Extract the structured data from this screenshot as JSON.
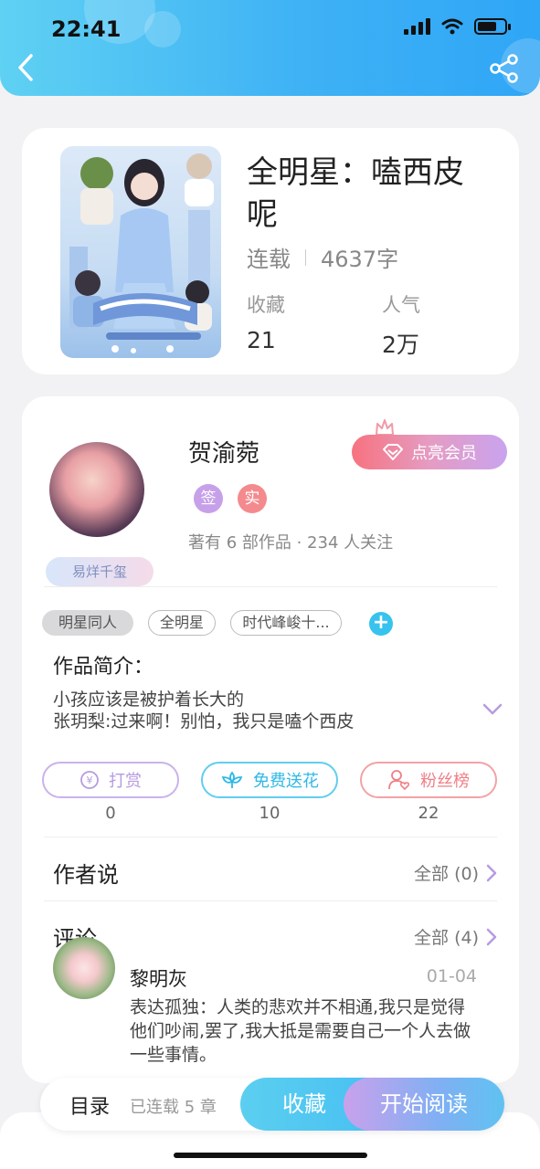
{
  "status_bar": {
    "time": "22:41"
  },
  "book": {
    "title": "全明星：嗑西皮呢",
    "status": "连载",
    "word_count": "4637字",
    "favorites_label": "收藏",
    "favorites_value": "21",
    "popularity_label": "人气",
    "popularity_value": "2万"
  },
  "author": {
    "name": "贺渝菀",
    "vip_label": "点亮会员",
    "tag_sign": "签",
    "tag_real": "实",
    "stats": "著有 6 部作品 · 234 人关注",
    "badge": "易烊千玺"
  },
  "tags": [
    "明星同人",
    "全明星",
    "时代峰峻十..."
  ],
  "intro": {
    "title": "作品简介：",
    "line1": "小孩应该是被护着长大的",
    "line2": "张玥梨:过来啊！别怕，我只是嗑个西皮"
  },
  "actions": [
    {
      "label": "打赏",
      "count": "0",
      "color": "#b9a2e3"
    },
    {
      "label": "免费送花",
      "count": "10",
      "color": "#3cc7ec"
    },
    {
      "label": "粉丝榜",
      "count": "22",
      "color": "#ef8a8f"
    }
  ],
  "author_says": {
    "title": "作者说",
    "link": "全部 (0)"
  },
  "comments": {
    "title": "评论",
    "link": "全部 (4)",
    "items": [
      {
        "user": "黎明灰",
        "date": "01-04",
        "text": "表达孤独：人类的悲欢并不相通,我只是觉得他们吵闹,罢了,我大抵是需要自己一个人去做一些事情。"
      }
    ]
  },
  "bottom_bar": {
    "toc_label": "目录",
    "toc_count": "已连载 5 章",
    "collect_label": "收藏",
    "read_label": "开始阅读"
  },
  "colors": {
    "header_accent": "#3fb2f5",
    "vip": "#f7727f",
    "purple": "#c9a1ec"
  }
}
